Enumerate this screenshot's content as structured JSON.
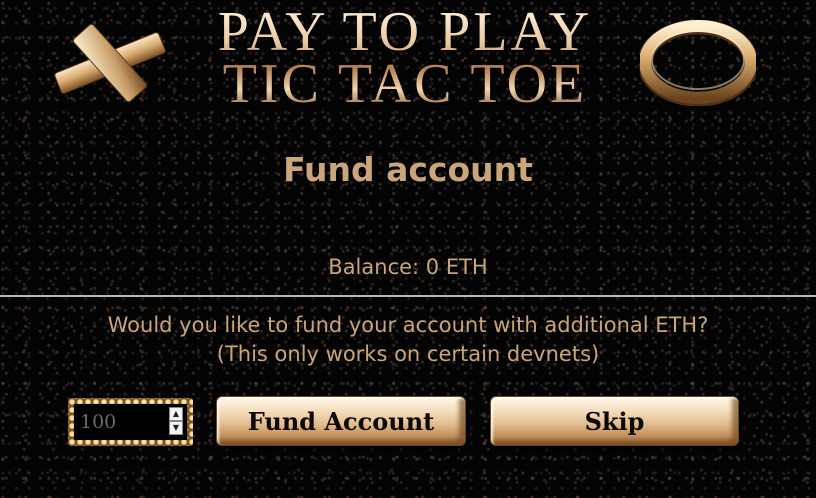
{
  "logo": {
    "title_line1": "PAY TO PLAY",
    "title_line2": "TIC TAC TOE",
    "x_icon": "gold-x-icon",
    "o_icon": "gold-ring-icon",
    "gold_color": "#d6b089"
  },
  "fund": {
    "heading": "Fund account",
    "balance": "Balance: 0 ETH",
    "question_line1": "Would you like to fund your account with additional ETH?",
    "question_line2": "(This only works on certain devnets)",
    "amount_placeholder": "100",
    "fund_button": "Fund Account",
    "skip_button": "Skip"
  },
  "colors": {
    "background": "#050404",
    "text": "#c9a57a",
    "divider": "#b8b8b8"
  }
}
